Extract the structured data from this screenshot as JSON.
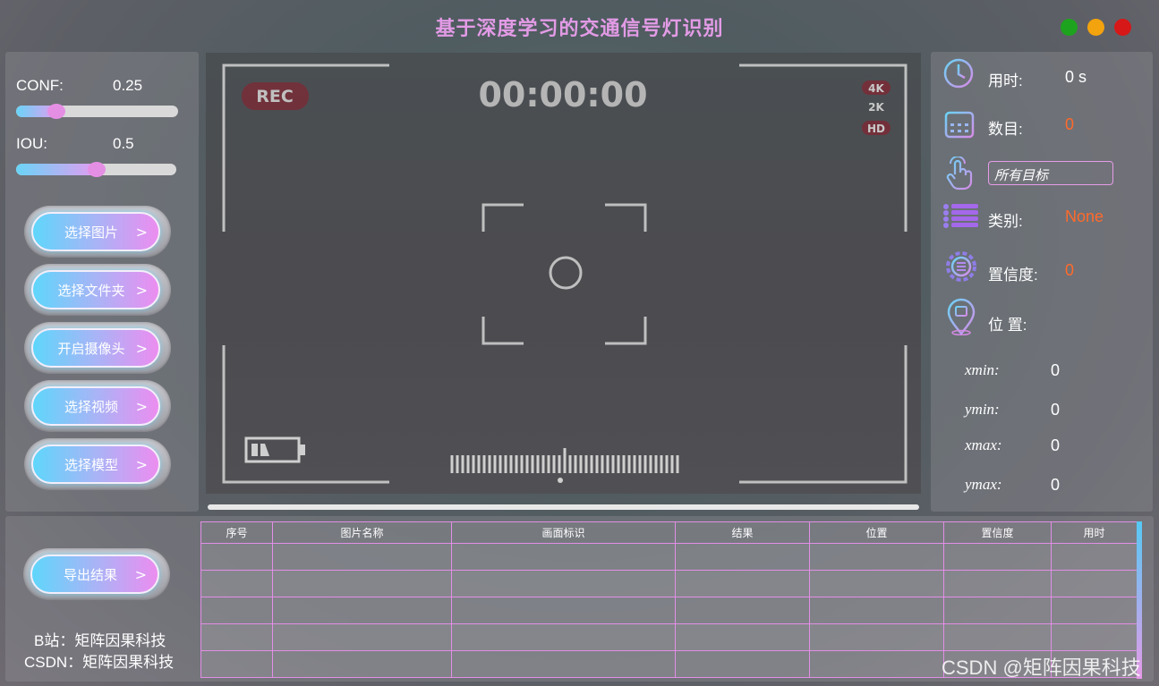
{
  "window": {
    "title": "基于深度学习的交通信号灯识别"
  },
  "params": {
    "conf_label": "CONF:",
    "conf_value": "0.25",
    "conf_level": 0.25,
    "iou_label": "IOU:",
    "iou_value": "0.5",
    "iou_level": 0.5
  },
  "buttons": {
    "select_image": "选择图片",
    "select_folder": "选择文件夹",
    "open_camera": "开启摄像头",
    "select_video": "选择视频",
    "select_model": "选择模型",
    "export_results": "导出结果",
    "arrow": ">"
  },
  "viewer": {
    "rec": "REC",
    "timecode": "00:00:00",
    "res_4k": "4K",
    "res_2k": "2K",
    "res_hd": "HD"
  },
  "stats": {
    "time_label": "用时:",
    "time_value": "0 s",
    "count_label": "数目:",
    "count_value": "0",
    "target_select": "所有目标",
    "class_label": "类别:",
    "class_value": "None",
    "conf_label": "置信度:",
    "conf_value": "0",
    "pos_label": "位 置:",
    "xmin_label": "xmin:",
    "xmin_value": "0",
    "ymin_label": "ymin:",
    "ymin_value": "0",
    "xmax_label": "xmax:",
    "xmax_value": "0",
    "ymax_label": "ymax:",
    "ymax_value": "0"
  },
  "table": {
    "headers": [
      "序号",
      "图片名称",
      "画面标识",
      "结果",
      "位置",
      "置信度",
      "用时"
    ],
    "row_count": 5
  },
  "credits": {
    "bilibili": "B站：矩阵因果科技",
    "csdn": "CSDN：矩阵因果科技",
    "watermark": "CSDN @矩阵因果科技"
  },
  "colors": {
    "title": "#e39be6",
    "accent_orange": "#ff6a2b",
    "table_border": "#e28ee6",
    "gradient_start": "#5fd6fb",
    "gradient_end": "#ec8df0"
  }
}
